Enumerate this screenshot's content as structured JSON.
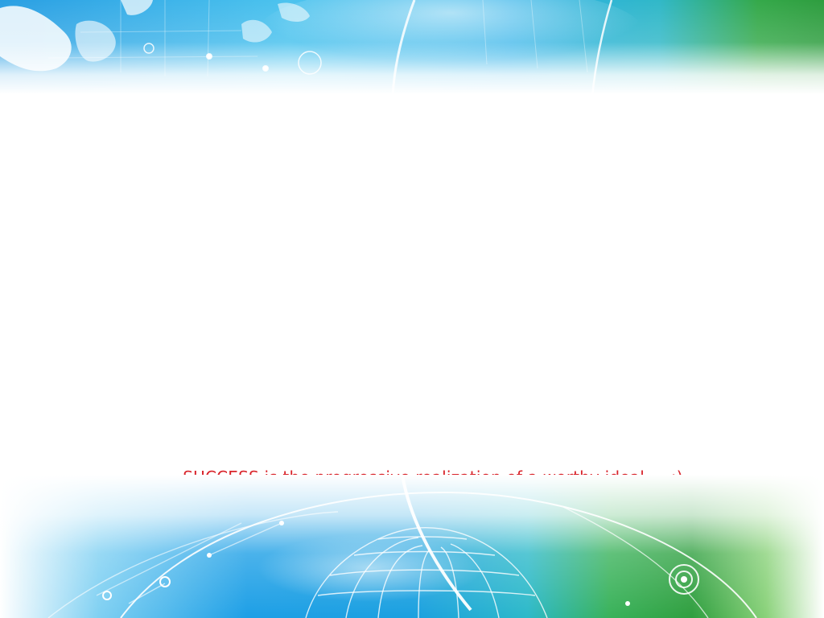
{
  "slide": {
    "quote": "SUCCESS is the progressive realization of a worthy ideal.... :)"
  },
  "colors": {
    "quote_text": "#d8232a",
    "background": "#ffffff",
    "blue": "#1c9fe0",
    "cyan": "#5fd0f0",
    "green": "#2fa84a",
    "light_green": "#8fd66a"
  },
  "decorations": {
    "top": "world-map-globe-banner",
    "bottom": "wireframe-globe-banner"
  }
}
